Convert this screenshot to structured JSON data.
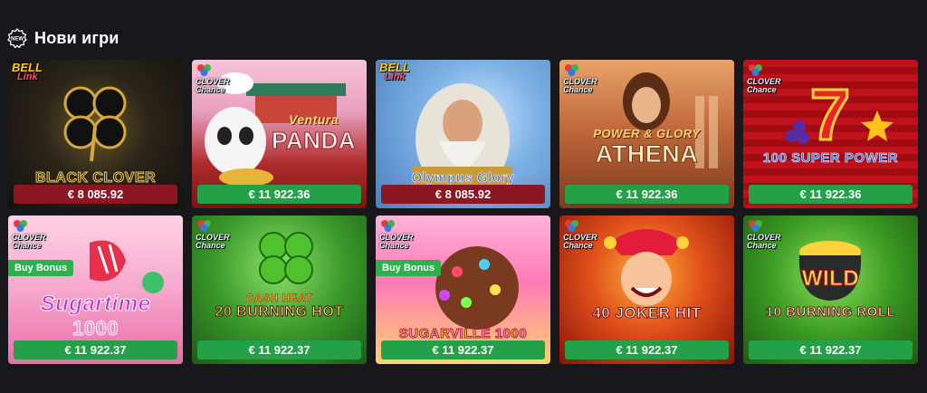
{
  "section": {
    "title": "Нови игри",
    "badge_icon": "new-badge-icon",
    "badge_text": "NEW"
  },
  "games": [
    {
      "name": "BLACK CLOVER",
      "provider": "bell",
      "provider_l1": "BELL",
      "provider_l2": "Link",
      "jackpot": "€ 8 085.92",
      "jackpot_color": "red",
      "buy_bonus": "",
      "bg": "dark-gold"
    },
    {
      "name_l1": "Ventura",
      "name_l2": "PANDA",
      "provider": "clover",
      "provider_l1": "CLOVER",
      "provider_l2": "Chance",
      "jackpot": "€ 11 922.36",
      "jackpot_color": "green",
      "buy_bonus": "",
      "bg": "panda"
    },
    {
      "name": "Olympus Glory",
      "provider": "bell",
      "provider_l1": "BELL",
      "provider_l2": "Link",
      "jackpot": "€ 8 085.92",
      "jackpot_color": "red",
      "buy_bonus": "",
      "bg": "zeus"
    },
    {
      "name_l1": "POWER & GLORY",
      "name_l2": "ATHENA",
      "provider": "clover",
      "provider_l1": "CLOVER",
      "provider_l2": "Chance",
      "jackpot": "€ 11 922.36",
      "jackpot_color": "green",
      "buy_bonus": "",
      "bg": "athena"
    },
    {
      "name": "100 SUPER POWER",
      "provider": "clover",
      "provider_l1": "CLOVER",
      "provider_l2": "Chance",
      "jackpot": "€ 11 922.36",
      "jackpot_color": "green",
      "buy_bonus": "",
      "bg": "seven"
    },
    {
      "name_l1": "Sugartime",
      "name_l2": "1000",
      "provider": "clover",
      "provider_l1": "CLOVER",
      "provider_l2": "Chance",
      "jackpot": "€ 11 922.37",
      "jackpot_color": "green",
      "buy_bonus": "Buy Bonus",
      "bg": "sugar"
    },
    {
      "name_l1": "CASH HEAT",
      "name_l2": "20 BURNING HOT",
      "provider": "clover",
      "provider_l1": "CLOVER",
      "provider_l2": "Chance",
      "jackpot": "€ 11 922.37",
      "jackpot_color": "green",
      "buy_bonus": "",
      "bg": "cashheat"
    },
    {
      "name": "SUGARVILLE 1000",
      "provider": "clover",
      "provider_l1": "CLOVER",
      "provider_l2": "Chance",
      "jackpot": "€ 11 922.37",
      "jackpot_color": "green",
      "buy_bonus": "Buy Bonus",
      "bg": "sugarville"
    },
    {
      "name": "40 JOKER HIT",
      "provider": "clover",
      "provider_l1": "CLOVER",
      "provider_l2": "Chance",
      "jackpot": "€ 11 922.37",
      "jackpot_color": "green",
      "buy_bonus": "",
      "bg": "joker"
    },
    {
      "name_l1": "WILD",
      "name_l2": "10 BURNING ROLL",
      "provider": "clover",
      "provider_l1": "CLOVER",
      "provider_l2": "Chance",
      "jackpot": "€ 11 922.37",
      "jackpot_color": "green",
      "buy_bonus": "",
      "bg": "burningroll"
    }
  ]
}
